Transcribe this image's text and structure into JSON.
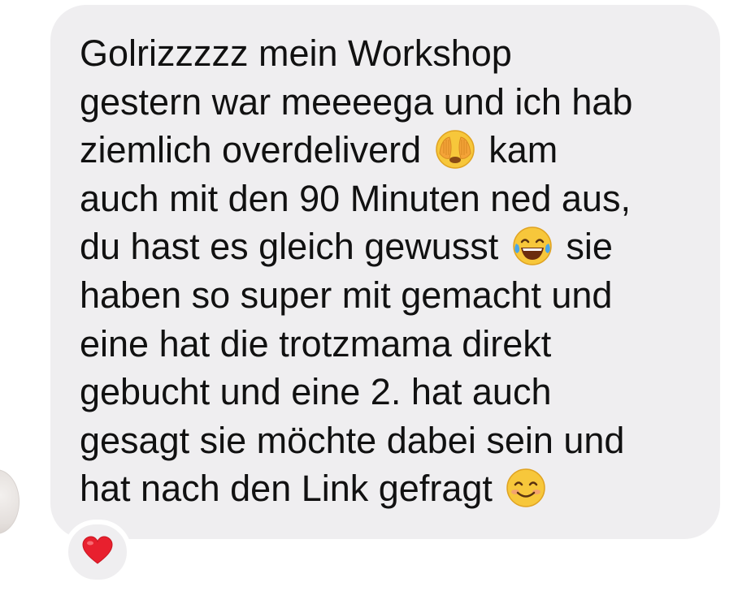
{
  "message": {
    "sender_avatar_icon": "avatar-icon",
    "lines": [
      {
        "text": "Golrizzzzz mein Workshop"
      },
      {
        "text": "gestern war meeeega und ich hab"
      },
      {
        "before": "ziemlich overdeliverd",
        "emoji": "face-with-hand-over-eyes-icon",
        "after": "kam"
      },
      {
        "text": "auch mit den 90 Minuten ned aus,"
      },
      {
        "before": "du hast es gleich gewusst",
        "emoji": "face-with-tears-of-joy-icon",
        "after": "sie"
      },
      {
        "text": "haben so super mit gemacht und"
      },
      {
        "text": "eine hat die trotzmama direkt"
      },
      {
        "text": "gebucht und eine 2. hat auch"
      },
      {
        "text": "gesagt sie möchte dabei sein und"
      },
      {
        "before": "hat nach den Link gefragt",
        "emoji": "smiling-face-icon",
        "after": ""
      }
    ],
    "bubble_color": "#efeef0",
    "text_color": "#111111"
  },
  "reaction": {
    "icon": "red-heart-icon",
    "color": "#e8202e"
  }
}
